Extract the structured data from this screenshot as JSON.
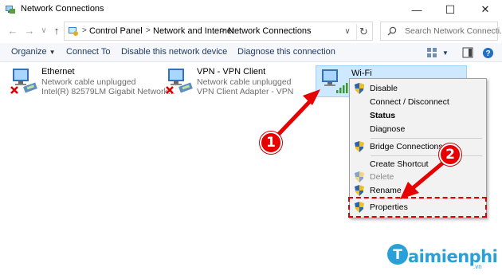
{
  "window": {
    "title": "Network Connections",
    "minimize_glyph": "—",
    "maximize_glyph": "☐",
    "close_glyph": "✕"
  },
  "nav": {
    "back_glyph": "←",
    "forward_glyph": "→",
    "recent_glyph": "∨",
    "up_glyph": "↑",
    "breadcrumb": [
      "Control Panel",
      "Network and Internet",
      "Network Connections"
    ],
    "crumb_separator": ">",
    "dropdown_glyph": "∨",
    "refresh_glyph": "↻",
    "search_placeholder": "Search Network Connecti..."
  },
  "commands": {
    "organize": "Organize",
    "organize_arrow": "▼",
    "connect_to": "Connect To",
    "disable_device": "Disable this network device",
    "diagnose": "Diagnose this connection",
    "view_arrow": "▼"
  },
  "connections": [
    {
      "name": "Ethernet",
      "status": "Network cable unplugged",
      "adapter": "Intel(R) 82579LM Gigabit Network...",
      "state": "disconnected"
    },
    {
      "name": "VPN - VPN Client",
      "status": "Network cable unplugged",
      "adapter": "VPN Client Adapter - VPN",
      "state": "disconnected"
    },
    {
      "name": "Wi-Fi",
      "state": "connected",
      "selected": true
    }
  ],
  "context_menu": {
    "items": [
      {
        "label": "Disable",
        "shield": true
      },
      {
        "label": "Connect / Disconnect",
        "shield": false
      },
      {
        "label": "Status",
        "shield": false,
        "bold": true
      },
      {
        "label": "Diagnose",
        "shield": false
      },
      {
        "label": "Bridge Connections",
        "shield": true
      },
      {
        "label": "Create Shortcut",
        "shield": false
      },
      {
        "label": "Delete",
        "shield": true,
        "disabled": true
      },
      {
        "label": "Rename",
        "shield": true
      },
      {
        "label": "Properties",
        "shield": true
      }
    ]
  },
  "annotations": {
    "step1": "1",
    "step2": "2",
    "accent_color": "#e60000"
  },
  "watermark": {
    "brand": "aimienphi",
    "tld": ".vn"
  },
  "colors": {
    "selection": "#cde8ff",
    "command_text": "#1e3b66",
    "logo_blue": "#2aa0d8"
  }
}
